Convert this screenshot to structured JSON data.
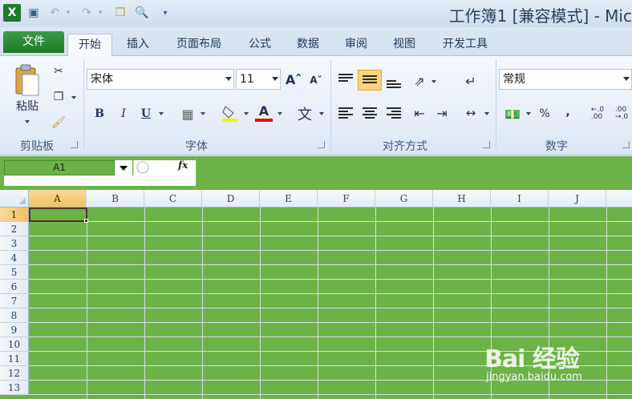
{
  "window": {
    "title": "工作簿1  [兼容模式] - Mic"
  },
  "tabs": [
    "文件",
    "开始",
    "插入",
    "页面布局",
    "公式",
    "数据",
    "审阅",
    "视图",
    "开发工具"
  ],
  "ribbon": {
    "clipboard": {
      "paste_label": "粘贴",
      "group_label": "剪贴板"
    },
    "font": {
      "font_name": "宋体",
      "font_size": "11",
      "bold": "B",
      "italic": "I",
      "underline": "U",
      "font_color_glyph": "A",
      "group_label": "字体"
    },
    "alignment": {
      "group_label": "对齐方式"
    },
    "number": {
      "format": "常规",
      "percent": "%",
      "comma": ",",
      "inc_decimal": "←.0\n.00",
      "dec_decimal": ".00\n→.0",
      "group_label": "数字"
    }
  },
  "formula_bar": {
    "name_box": "A1",
    "fx": "fx"
  },
  "grid": {
    "columns": [
      "A",
      "B",
      "C",
      "D",
      "E",
      "F",
      "G",
      "H",
      "I",
      "J"
    ],
    "rows": [
      "1",
      "2",
      "3",
      "4",
      "5",
      "6",
      "7",
      "8",
      "9",
      "10",
      "11",
      "12",
      "13"
    ],
    "selected_cell": "A1"
  },
  "watermark": {
    "logo": "Bai 经验",
    "url": "jingyan.baidu.com"
  },
  "colors": {
    "sheet_fill": "#6cb247",
    "file_tab": "#2a8a35",
    "selected_header": "#f1c15f"
  }
}
